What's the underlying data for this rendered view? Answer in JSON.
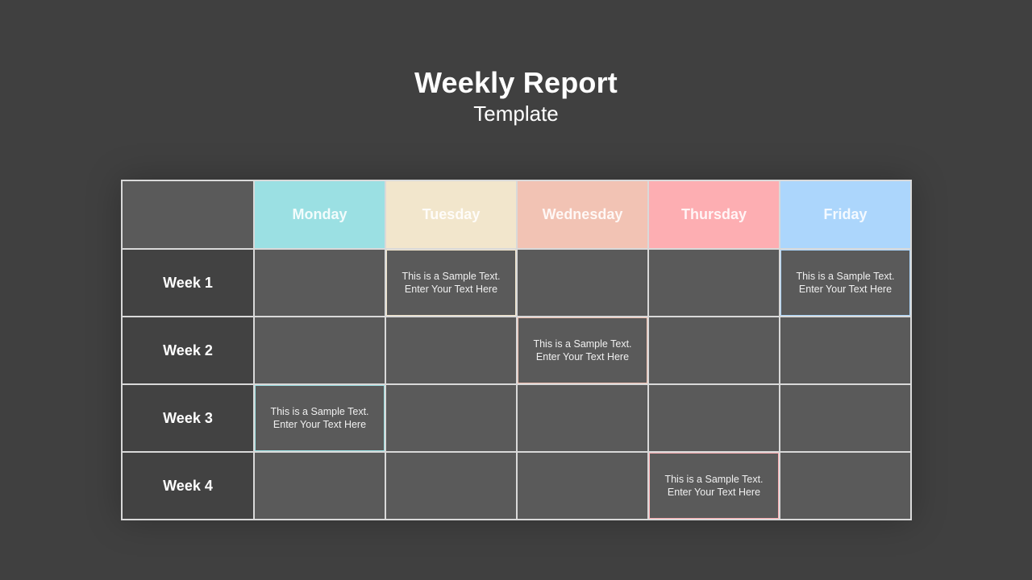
{
  "header": {
    "title": "Weekly Report",
    "subtitle": "Template"
  },
  "table": {
    "days": [
      {
        "label": "Monday",
        "color": "#9be0e3"
      },
      {
        "label": "Tuesday",
        "color": "#f2e6cc"
      },
      {
        "label": "Wednesday",
        "color": "#f2c3b4"
      },
      {
        "label": "Thursday",
        "color": "#fdaeb2"
      },
      {
        "label": "Friday",
        "color": "#acd6fc"
      }
    ],
    "weeks": [
      {
        "label": "Week 1",
        "notes": [
          "",
          "This is a Sample Text.\nEnter Your Text Here",
          "",
          "",
          "This is a Sample Text.\nEnter Your Text Here"
        ]
      },
      {
        "label": "Week 2",
        "notes": [
          "",
          "",
          "This is a Sample Text.\nEnter Your Text Here",
          "",
          ""
        ]
      },
      {
        "label": "Week 3",
        "notes": [
          "This is a Sample Text.\nEnter Your Text Here",
          "",
          "",
          "",
          ""
        ]
      },
      {
        "label": "Week 4",
        "notes": [
          "",
          "",
          "",
          "This is a Sample Text.\nEnter Your Text Here",
          ""
        ]
      }
    ]
  }
}
